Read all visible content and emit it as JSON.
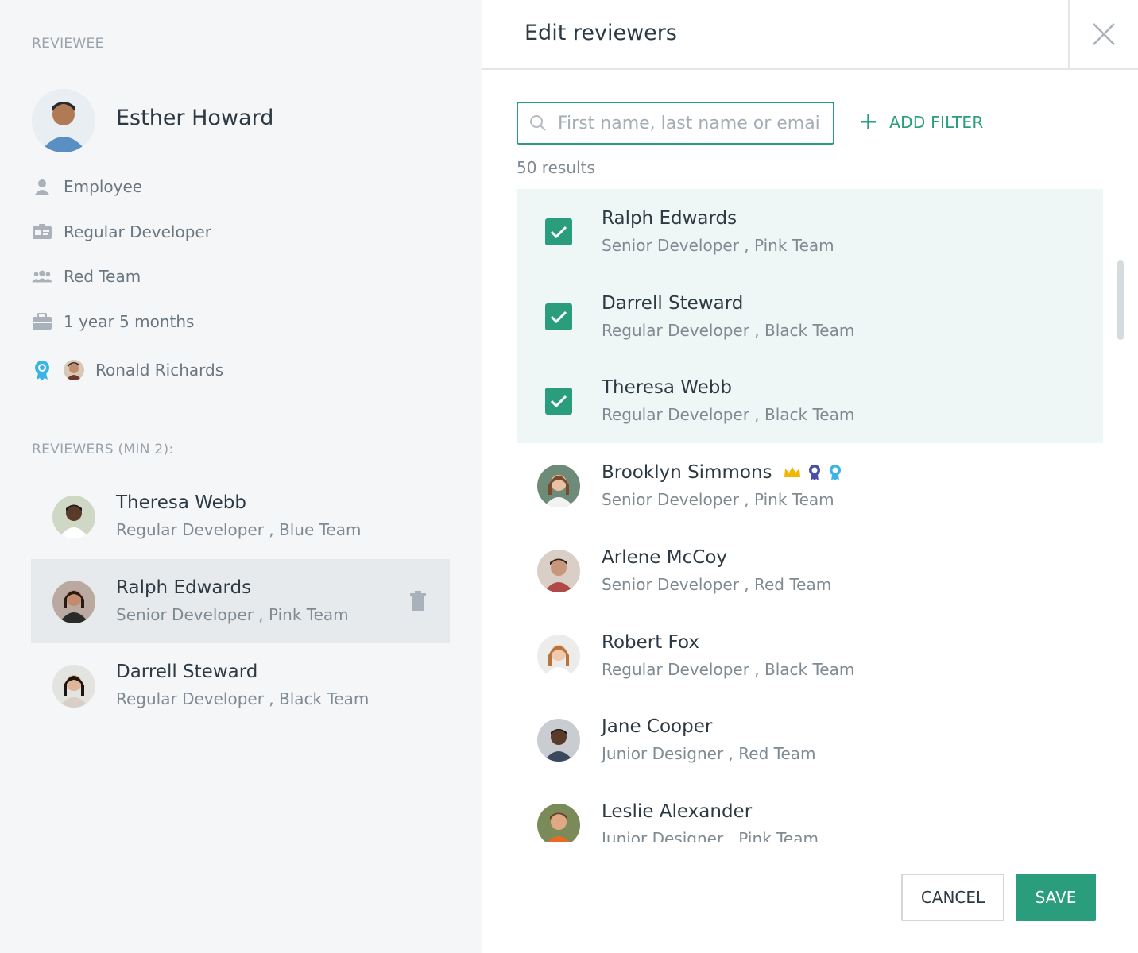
{
  "reviewee": {
    "section_label": "REVIEWEE",
    "name": "Esther Howard",
    "role_type": "Employee",
    "position": "Regular Developer",
    "team": "Red Team",
    "tenure": "1 year 5 months",
    "mentor": "Ronald Richards"
  },
  "reviewers": {
    "section_label": "REVIEWERS (MIN 2):",
    "items": [
      {
        "name": "Theresa Webb",
        "subtitle": "Regular Developer , Blue Team"
      },
      {
        "name": "Ralph Edwards",
        "subtitle": "Senior Developer , Pink Team"
      },
      {
        "name": "Darrell Steward",
        "subtitle": "Regular Developer , Black Team"
      }
    ]
  },
  "dialog": {
    "title": "Edit reviewers",
    "search_placeholder": "First name, last name or email",
    "add_filter_label": "ADD FILTER",
    "results_text": "50 results",
    "cancel_label": "CANCEL",
    "save_label": "SAVE"
  },
  "candidates": [
    {
      "name": "Ralph Edwards",
      "subtitle": "Senior Developer , Pink Team",
      "checked": true
    },
    {
      "name": "Darrell Steward",
      "subtitle": "Regular Developer , Black Team",
      "checked": true
    },
    {
      "name": "Theresa Webb",
      "subtitle": "Regular Developer , Black Team",
      "checked": true
    },
    {
      "name": "Brooklyn Simmons",
      "subtitle": "Senior Developer , Pink Team",
      "checked": false,
      "badges": [
        "crown-icon",
        "medal-purple-icon",
        "medal-blue-icon"
      ]
    },
    {
      "name": "Arlene McCoy",
      "subtitle": "Senior Developer , Red Team",
      "checked": false
    },
    {
      "name": "Robert Fox",
      "subtitle": "Regular Developer , Black Team",
      "checked": false
    },
    {
      "name": "Jane Cooper",
      "subtitle": "Junior Designer , Red Team",
      "checked": false
    },
    {
      "name": "Leslie Alexander",
      "subtitle": "Junior Designer , Pink Team",
      "checked": false
    }
  ],
  "colors": {
    "accent": "#2a9d7c",
    "left_panel_bg": "#f4f6f8",
    "checked_row_bg": "#eff7f6",
    "selected_item_bg": "#e6eaed"
  }
}
